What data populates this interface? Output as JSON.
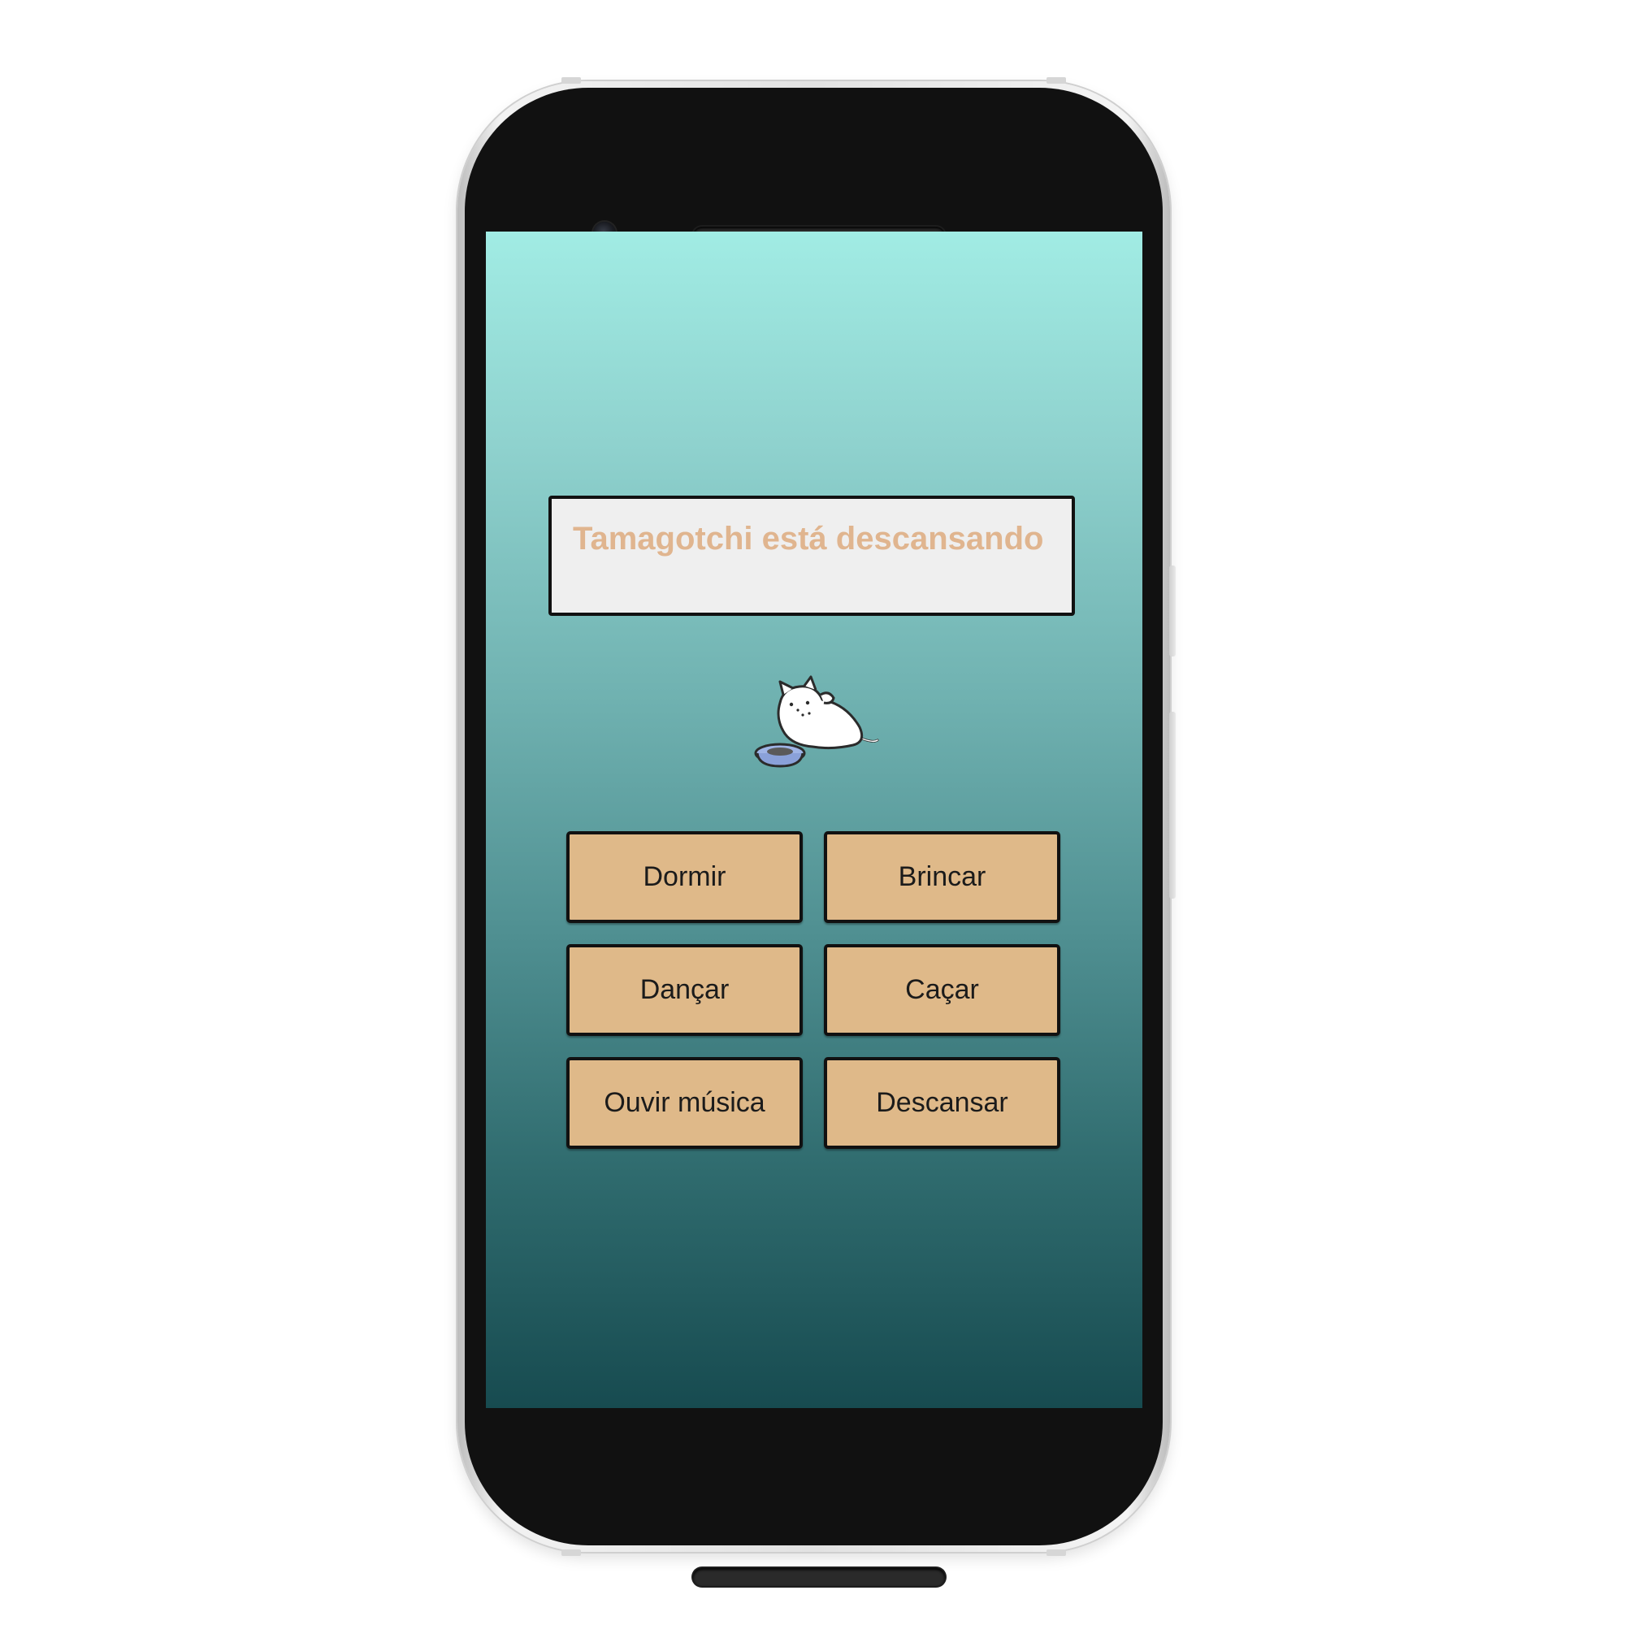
{
  "app": {
    "status_text": "Tamagotchi está descansando",
    "pet_icon": "cat-eating-icon"
  },
  "actions": [
    {
      "label": "Dormir"
    },
    {
      "label": "Brincar"
    },
    {
      "label": "Dançar"
    },
    {
      "label": "Caçar"
    },
    {
      "label": "Ouvir música"
    },
    {
      "label": "Descansar"
    }
  ],
  "colors": {
    "screen_top": "#a1ece4",
    "screen_bottom": "#174b50",
    "status_text": "#e0b58f",
    "status_box": "#efefef",
    "button_fill": "#dfb989",
    "button_border": "#111111"
  }
}
